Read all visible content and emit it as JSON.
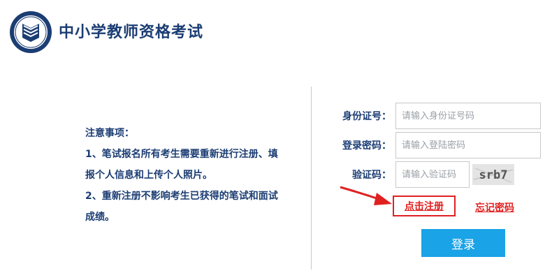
{
  "header": {
    "title": "中小学教师资格考试",
    "logo_icon": "book-shield-emblem-icon"
  },
  "notice": {
    "heading": "注意事项：",
    "lines": [
      "1、笔试报名所有考生需要重新进行注册、填",
      "报个人信息和上传个人照片。",
      "2、重新注册不影响考生已获得的笔试和面试",
      "成绩。"
    ]
  },
  "form": {
    "id_label": "身份证号：",
    "id_placeholder": "请输入身份证号码",
    "password_label": "登录密码：",
    "password_placeholder": "请输入登陆密码",
    "captcha_label": "验证码：",
    "captcha_placeholder": "请输入验证码",
    "captcha_text": "srb7",
    "register_link": "点击注册",
    "forgot_link": "忘记密码",
    "login_button": "登录"
  },
  "colors": {
    "title": "#1b3d73",
    "accent_button": "#1aa3e6",
    "highlight": "#e02020"
  }
}
